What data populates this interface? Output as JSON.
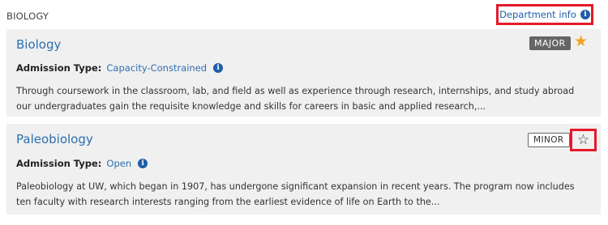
{
  "header": {
    "section_title": "BIOLOGY",
    "department_info_label": "Department info"
  },
  "icons": {
    "info": "info-icon",
    "star_filled": "star-filled-icon",
    "star_outline": "star-outline-icon"
  },
  "colors": {
    "link": "#2f6fae",
    "highlight_border": "#e5192a",
    "star_active": "#f4a221",
    "card_bg": "#f0f0f0"
  },
  "programs": [
    {
      "title": "Biology",
      "badge": "MAJOR",
      "favorited": true,
      "admission_label": "Admission Type:",
      "admission_value": "Capacity-Constrained",
      "description": "Through coursework in the classroom, lab, and field as well as experience through research, internships, and study abroad our undergraduates gain the requisite knowledge and skills for careers in basic and applied research,..."
    },
    {
      "title": "Paleobiology",
      "badge": "MINOR",
      "favorited": false,
      "admission_label": "Admission Type:",
      "admission_value": "Open",
      "description": "Paleobiology at UW, which began in 1907, has undergone significant expansion in recent years. The program now includes ten faculty with research interests ranging from the earliest evidence of life on Earth to the..."
    }
  ]
}
